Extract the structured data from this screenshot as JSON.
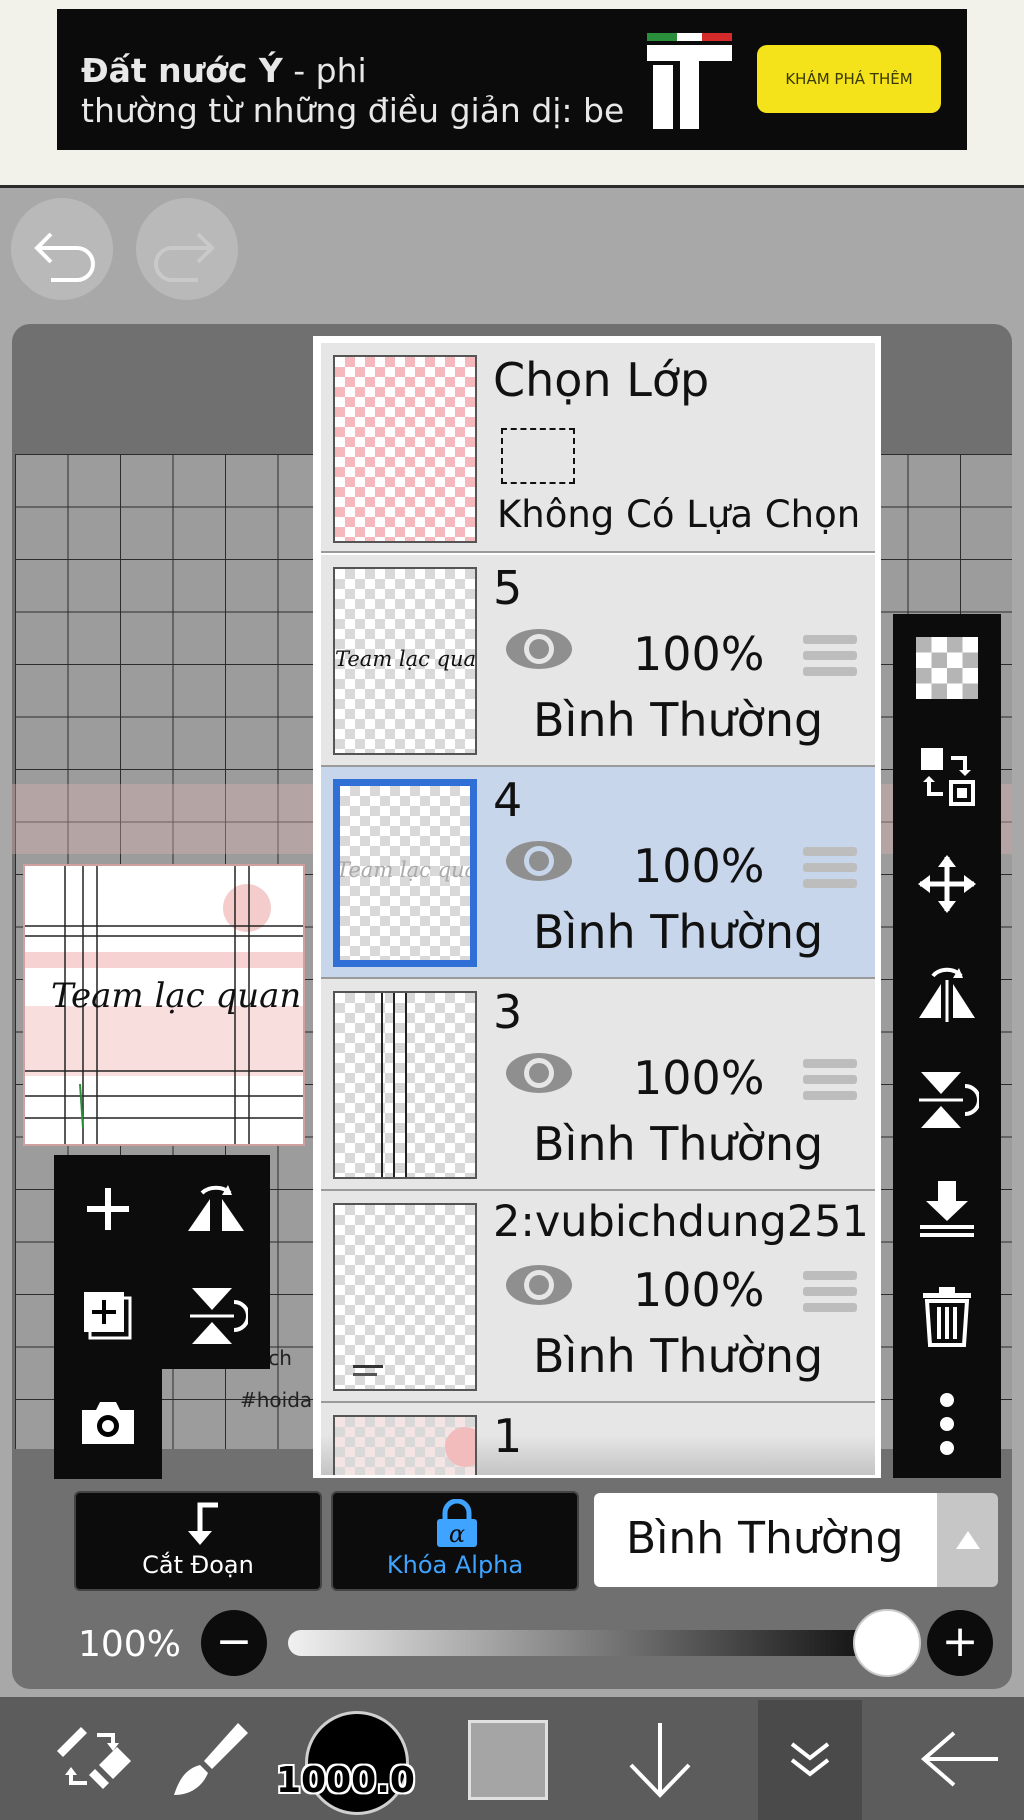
{
  "ad": {
    "line1_bold": "Đất nước Ý",
    "line1_rest": " - phi",
    "line2": "thường từ những điều giản dị: be",
    "cta": "KHÁM PHÁ THÊM"
  },
  "layer_panel": {
    "selection_layer": {
      "title": "Chọn Lớp",
      "status": "Không Có Lựa Chọn"
    },
    "layers": [
      {
        "name": "5",
        "opacity": "100%",
        "blend": "Bình Thường",
        "thumb_text": "Team lạc quan",
        "selected": false
      },
      {
        "name": "4",
        "opacity": "100%",
        "blend": "Bình Thường",
        "thumb_text": "Team lạc quan",
        "selected": true
      },
      {
        "name": "3",
        "opacity": "100%",
        "blend": "Bình Thường",
        "selected": false
      },
      {
        "name": "2:vubichdung251",
        "opacity": "100%",
        "blend": "Bình Thường",
        "selected": false
      },
      {
        "name": "1"
      }
    ]
  },
  "preview": {
    "title": "Team lạc quan"
  },
  "canvas": {
    "partial_text_1": "bich",
    "partial_text_2": "#hoida"
  },
  "actions": {
    "cut_label": "Cắt Đoạn",
    "alpha_lock_label": "Khóa Alpha",
    "blend_mode": "Bình Thường"
  },
  "opacity": {
    "label": "100%",
    "value": 1.0
  },
  "toolbar": {
    "brush_size": "1000.0",
    "color": "#a5a5a5"
  },
  "colors": {
    "selected_border": "#2f6fd6",
    "alpha_lock_accent": "#3fa4ff",
    "ad_cta": "#f4e21a"
  }
}
